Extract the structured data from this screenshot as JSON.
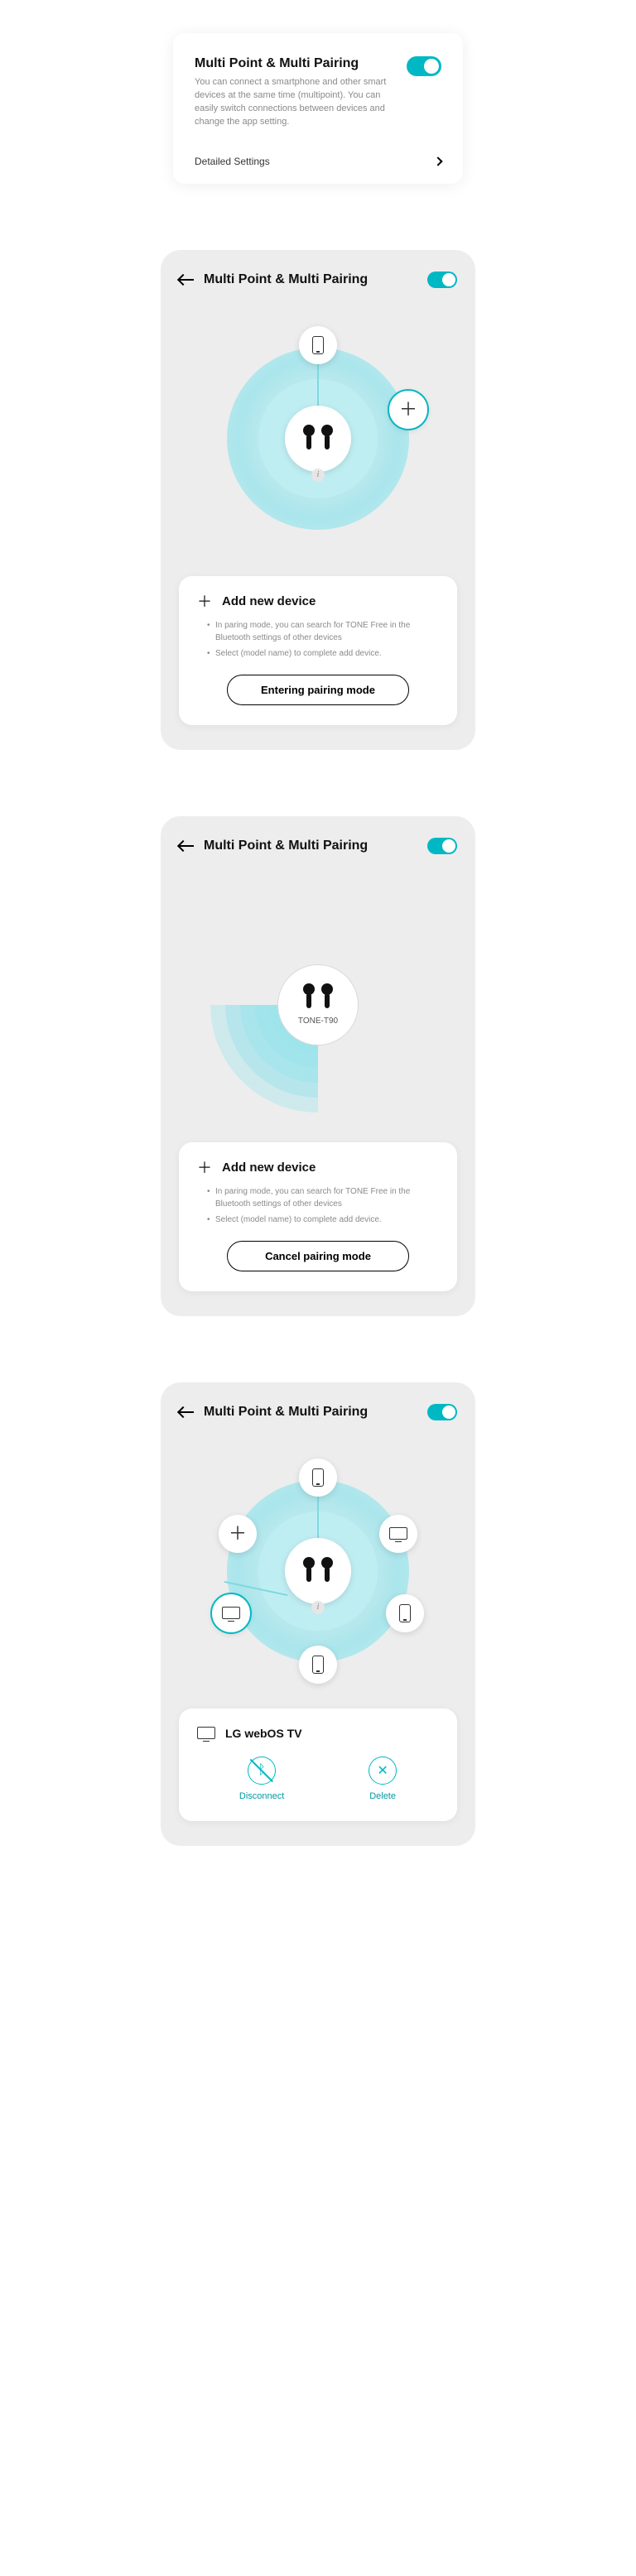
{
  "card0": {
    "title": "Multi Point & Multi Pairing",
    "desc": "You can connect a smartphone and other smart devices at the same time (multipoint). You can easily switch connections between devices and change the app setting.",
    "link": "Detailed Settings"
  },
  "header": {
    "title": "Multi Point & Multi Pairing"
  },
  "addCard": {
    "heading": "Add new device",
    "bullet1": "In paring mode, you can search for TONE Free in the Bluetooth settings of other devices",
    "bullet2": "Select (model name) to complete add device.",
    "enter_btn": "Entering pairing mode",
    "cancel_btn": "Cancel pairing mode"
  },
  "radar": {
    "model": "TONE-T90"
  },
  "device": {
    "name": "LG webOS TV",
    "disconnect": "Disconnect",
    "delete": "Delete"
  }
}
